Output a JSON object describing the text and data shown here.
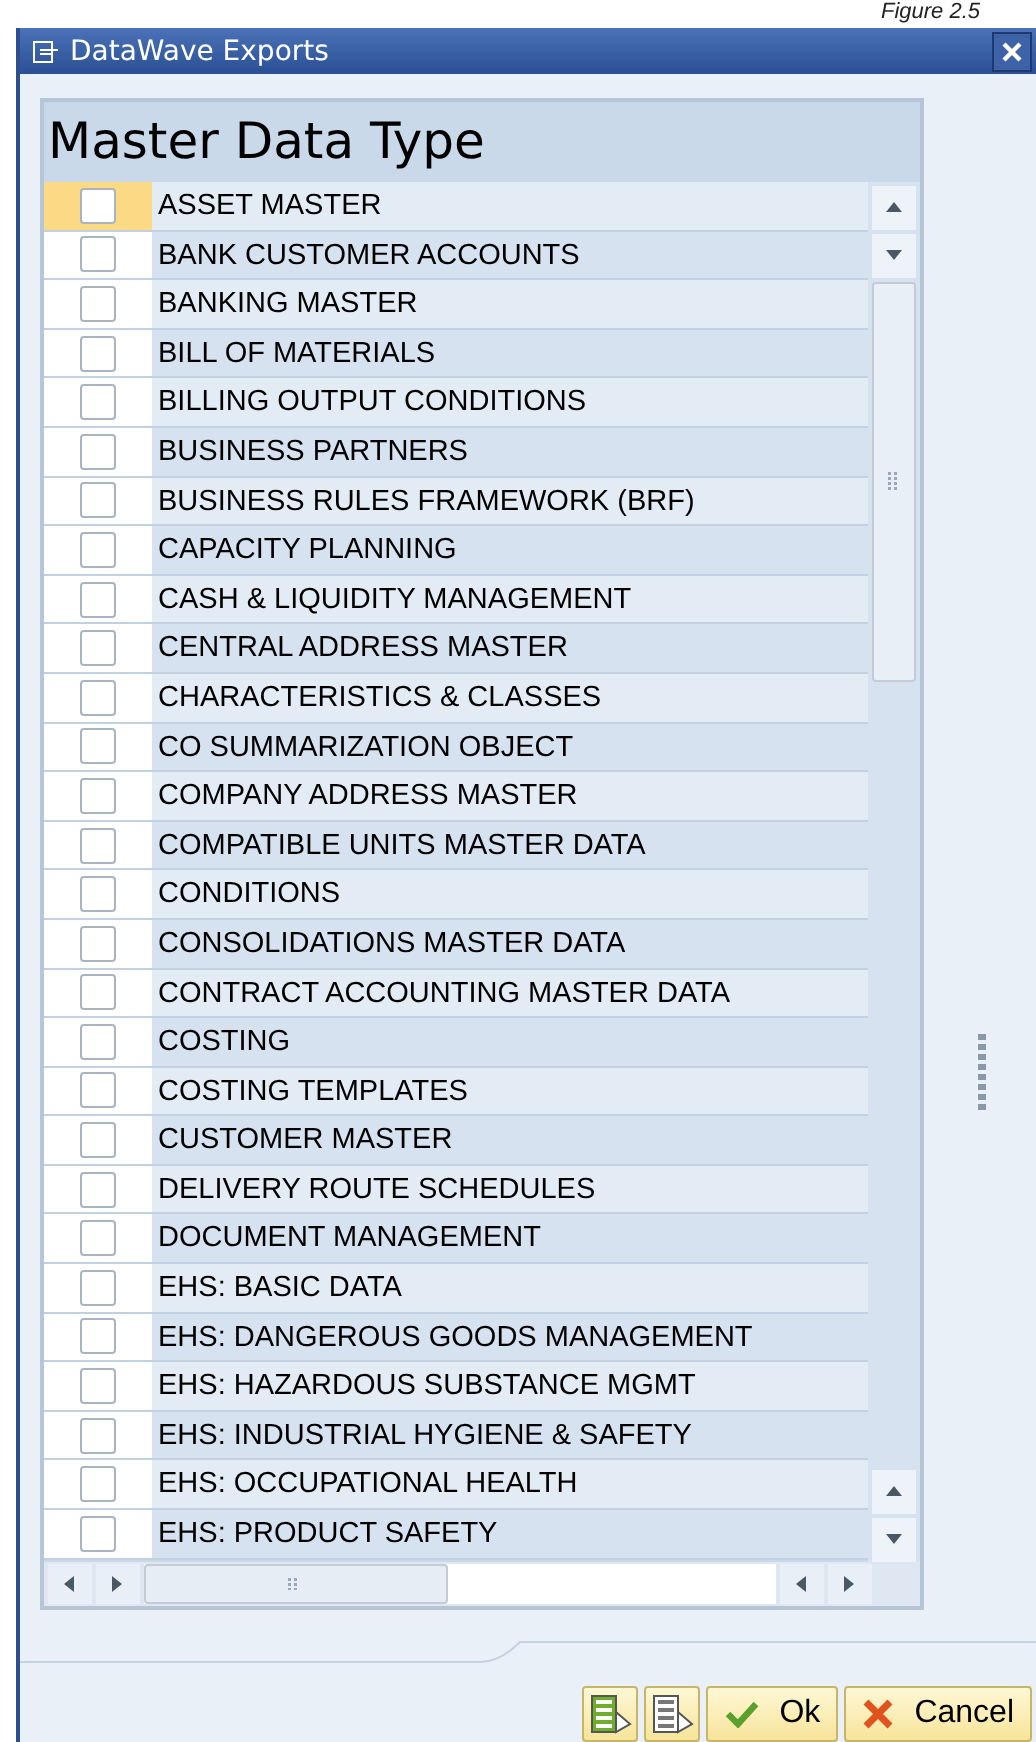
{
  "caption": "Figure 2.5",
  "window": {
    "title": "DataWave Exports"
  },
  "table": {
    "heading": "Master Data Type",
    "rows": [
      {
        "label": "ASSET MASTER",
        "checked": false,
        "selected": true
      },
      {
        "label": "BANK CUSTOMER ACCOUNTS",
        "checked": false,
        "selected": false
      },
      {
        "label": "BANKING MASTER",
        "checked": false,
        "selected": false
      },
      {
        "label": "BILL OF MATERIALS",
        "checked": false,
        "selected": false
      },
      {
        "label": "BILLING OUTPUT CONDITIONS",
        "checked": false,
        "selected": false
      },
      {
        "label": "BUSINESS PARTNERS",
        "checked": false,
        "selected": false
      },
      {
        "label": "BUSINESS RULES FRAMEWORK (BRF)",
        "checked": false,
        "selected": false
      },
      {
        "label": "CAPACITY PLANNING",
        "checked": false,
        "selected": false
      },
      {
        "label": "CASH & LIQUIDITY MANAGEMENT",
        "checked": false,
        "selected": false
      },
      {
        "label": "CENTRAL ADDRESS MASTER",
        "checked": false,
        "selected": false
      },
      {
        "label": "CHARACTERISTICS & CLASSES",
        "checked": false,
        "selected": false
      },
      {
        "label": "CO SUMMARIZATION OBJECT",
        "checked": false,
        "selected": false
      },
      {
        "label": "COMPANY ADDRESS MASTER",
        "checked": false,
        "selected": false
      },
      {
        "label": "COMPATIBLE UNITS MASTER DATA",
        "checked": false,
        "selected": false
      },
      {
        "label": "CONDITIONS",
        "checked": false,
        "selected": false
      },
      {
        "label": "CONSOLIDATIONS MASTER DATA",
        "checked": false,
        "selected": false
      },
      {
        "label": "CONTRACT ACCOUNTING MASTER DATA",
        "checked": false,
        "selected": false
      },
      {
        "label": "COSTING",
        "checked": false,
        "selected": false
      },
      {
        "label": "COSTING TEMPLATES",
        "checked": false,
        "selected": false
      },
      {
        "label": "CUSTOMER MASTER",
        "checked": false,
        "selected": false
      },
      {
        "label": "DELIVERY ROUTE SCHEDULES",
        "checked": false,
        "selected": false
      },
      {
        "label": "DOCUMENT MANAGEMENT",
        "checked": false,
        "selected": false
      },
      {
        "label": "EHS: BASIC DATA",
        "checked": false,
        "selected": false
      },
      {
        "label": "EHS: DANGEROUS GOODS MANAGEMENT",
        "checked": false,
        "selected": false
      },
      {
        "label": "EHS: HAZARDOUS SUBSTANCE MGMT",
        "checked": false,
        "selected": false
      },
      {
        "label": "EHS: INDUSTRIAL HYGIENE & SAFETY",
        "checked": false,
        "selected": false
      },
      {
        "label": "EHS: OCCUPATIONAL HEALTH",
        "checked": false,
        "selected": false
      },
      {
        "label": "EHS: PRODUCT SAFETY",
        "checked": false,
        "selected": false
      }
    ]
  },
  "buttons": [
    {
      "kind": "select-all"
    },
    {
      "kind": "deselect-all"
    },
    {
      "kind": "ok",
      "label": "Ok"
    },
    {
      "kind": "cancel",
      "label": "Cancel"
    }
  ]
}
